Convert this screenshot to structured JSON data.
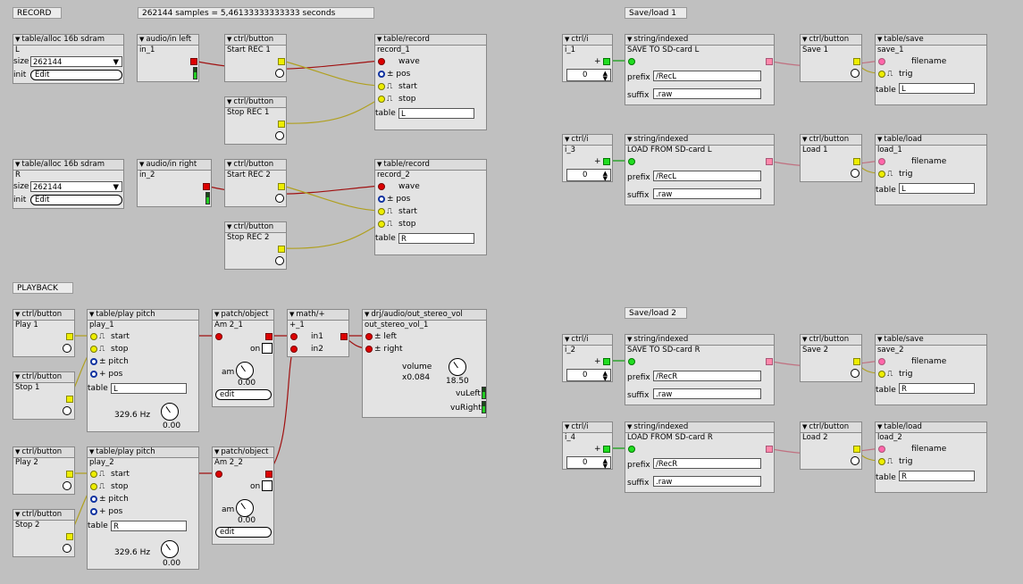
{
  "comments": {
    "record": "RECORD",
    "samples": "262144 samples    = 5,46133333333333 seconds",
    "playback": "PLAYBACK",
    "saveload1": "Save/load 1",
    "saveload2": "Save/load 2"
  },
  "alloc1": {
    "type": "table/alloc 16b sdram",
    "name": "L",
    "size_label": "size",
    "size_value": "262144",
    "init_label": "init",
    "edit": "Edit"
  },
  "alloc2": {
    "type": "table/alloc 16b sdram",
    "name": "R",
    "size_label": "size",
    "size_value": "262144",
    "init_label": "init",
    "edit": "Edit"
  },
  "audioin1": {
    "type": "audio/in left",
    "name": "in_1"
  },
  "audioin2": {
    "type": "audio/in right",
    "name": "in_2"
  },
  "btn_startrec1": {
    "type": "ctrl/button",
    "name": "Start REC 1"
  },
  "btn_stoprec1": {
    "type": "ctrl/button",
    "name": "Stop REC 1"
  },
  "btn_startrec2": {
    "type": "ctrl/button",
    "name": "Start REC 2"
  },
  "btn_stoprec2": {
    "type": "ctrl/button",
    "name": "Stop REC 2"
  },
  "record1": {
    "type": "table/record",
    "name": "record_1",
    "wave": "wave",
    "pos": "± pos",
    "start": "start",
    "stop": "stop",
    "table_label": "table",
    "table": "L"
  },
  "record2": {
    "type": "table/record",
    "name": "record_2",
    "wave": "wave",
    "pos": "± pos",
    "start": "start",
    "stop": "stop",
    "table_label": "table",
    "table": "R"
  },
  "btn_play1": {
    "type": "ctrl/button",
    "name": "Play 1"
  },
  "btn_stop1": {
    "type": "ctrl/button",
    "name": "Stop 1"
  },
  "btn_play2": {
    "type": "ctrl/button",
    "name": "Play 2"
  },
  "btn_stop2": {
    "type": "ctrl/button",
    "name": "Stop 2"
  },
  "play1": {
    "type": "table/play pitch",
    "name": "play_1",
    "start": "start",
    "stop": "stop",
    "pitch": "± pitch",
    "pos": "+ pos",
    "table_label": "table",
    "table": "L",
    "freq": "329.6 Hz",
    "knob_value": "0.00"
  },
  "play2": {
    "type": "table/play pitch",
    "name": "play_2",
    "start": "start",
    "stop": "stop",
    "pitch": "± pitch",
    "pos": "+ pos",
    "table_label": "table",
    "table": "R",
    "freq": "329.6 Hz",
    "knob_value": "0.00"
  },
  "am1": {
    "type": "patch/object",
    "name": "Am 2_1",
    "on": "on",
    "am": "am",
    "knob_value": "0.00",
    "edit": "edit"
  },
  "am2": {
    "type": "patch/object",
    "name": "Am 2_2",
    "on": "on",
    "am": "am",
    "knob_value": "0.00",
    "edit": "edit"
  },
  "mathplus": {
    "type": "math/+",
    "name": "+_1",
    "in1": "in1",
    "in2": "in2"
  },
  "outstereo": {
    "type": "drj/audio/out_stereo_vol",
    "name": "out_stereo_vol_1",
    "left": "± left",
    "right": "± right",
    "volume_label": "volume",
    "volume_mult": "x0.084",
    "knob_value": "18.50",
    "vuleft": "vuLeft",
    "vuright": "vuRight"
  },
  "i1": {
    "type": "ctrl/i",
    "name": "i_1",
    "value": "0"
  },
  "i3": {
    "type": "ctrl/i",
    "name": "i_3",
    "value": "0"
  },
  "i2": {
    "type": "ctrl/i",
    "name": "i_2",
    "value": "0"
  },
  "i4": {
    "type": "ctrl/i",
    "name": "i_4",
    "value": "0"
  },
  "str1": {
    "type": "string/indexed",
    "name": "SAVE TO SD-card L",
    "prefix_label": "prefix",
    "prefix": "/RecL",
    "suffix_label": "suffix",
    "suffix": ".raw"
  },
  "str3": {
    "type": "string/indexed",
    "name": "LOAD FROM SD-card L",
    "prefix_label": "prefix",
    "prefix": "/RecL",
    "suffix_label": "suffix",
    "suffix": ".raw"
  },
  "str2": {
    "type": "string/indexed",
    "name": "SAVE TO SD-card R",
    "prefix_label": "prefix",
    "prefix": "/RecR",
    "suffix_label": "suffix",
    "suffix": ".raw"
  },
  "str4": {
    "type": "string/indexed",
    "name": "LOAD FROM SD-card R",
    "prefix_label": "prefix",
    "prefix": "/RecR",
    "suffix_label": "suffix",
    "suffix": ".raw"
  },
  "btn_save1": {
    "type": "ctrl/button",
    "name": "Save 1"
  },
  "btn_load1": {
    "type": "ctrl/button",
    "name": "Load 1"
  },
  "btn_save2": {
    "type": "ctrl/button",
    "name": "Save 2"
  },
  "btn_load2": {
    "type": "ctrl/button",
    "name": "Load 2"
  },
  "save1": {
    "type": "table/save",
    "name": "save_1",
    "filename": "filename",
    "trig": "trig",
    "table_label": "table",
    "table": "L"
  },
  "load1": {
    "type": "table/load",
    "name": "load_1",
    "filename": "filename",
    "trig": "trig",
    "table_label": "table",
    "table": "L"
  },
  "save2": {
    "type": "table/save",
    "name": "save_2",
    "filename": "filename",
    "trig": "trig",
    "table_label": "table",
    "table": "R"
  },
  "load2": {
    "type": "table/load",
    "name": "load_2",
    "filename": "filename",
    "trig": "trig",
    "table_label": "table",
    "table": "R"
  },
  "colors": {
    "background": "#c0c0c0",
    "wire_audio": "#a01010",
    "wire_bool": "#b0a020",
    "wire_int": "#10a010",
    "wire_string": "#c07080"
  }
}
